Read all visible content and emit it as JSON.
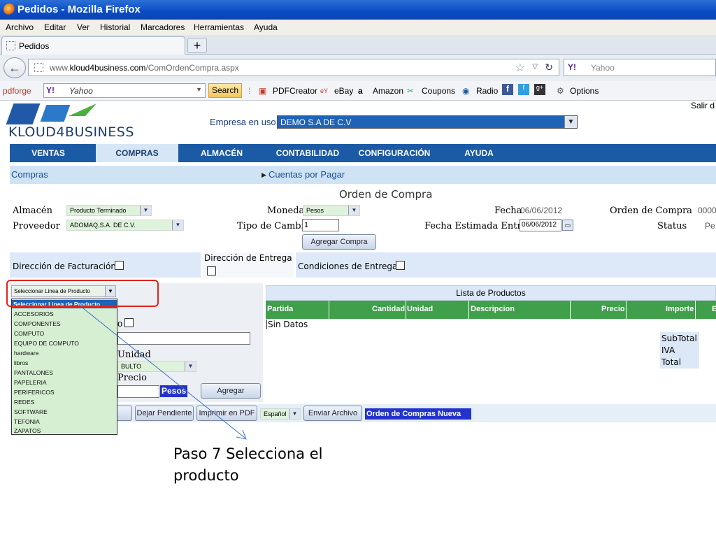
{
  "browser": {
    "window_title": "Pedidos - Mozilla Firefox",
    "menu": [
      "Archivo",
      "Editar",
      "Ver",
      "Historial",
      "Marcadores",
      "Herramientas",
      "Ayuda"
    ],
    "tab_label": "Pedidos",
    "new_tab": "+",
    "back": "←",
    "url_prefix": "www.",
    "url_domain": "kloud4business.com",
    "url_path": "/ComOrdenCompra.aspx",
    "search_engine": "Y!",
    "search_placeholder": "Yahoo",
    "toolbar": {
      "pdfforge": "pdforge",
      "yahoo_engine": "Y!",
      "yahoo_box": "Yahoo",
      "search_btn": "Search",
      "items": [
        "PDFCreator",
        "eBay",
        "Amazon",
        "Coupons",
        "Radio",
        "Options"
      ]
    }
  },
  "app": {
    "logo": "KLOUD4BUSINESS",
    "logout": "Salir d",
    "empresa_label": "Empresa en uso:",
    "empresa_value": "DEMO S.A DE C.V",
    "nav": [
      "VENTAS",
      "COMPRAS",
      "ALMACÉN",
      "CONTABILIDAD",
      "CONFIGURACIÓN",
      "AYUDA"
    ],
    "subnav_left": "Compras",
    "subnav_right": "Cuentas por Pagar",
    "page_title": "Orden de Compra",
    "form": {
      "almacen_label": "Almacén",
      "almacen_value": "Producto Terminado",
      "proveedor_label": "Proveedor",
      "proveedor_value": "ADOMAQ,S.A. DE C.V.",
      "moneda_label": "Moneda",
      "moneda_value": "Pesos",
      "tipo_cambio_label": "Tipo de Cambio",
      "tipo_cambio_value": "1",
      "fecha_label": "Fecha",
      "fecha_value": "06/06/2012",
      "fecha_entrega_label": "Fecha Estimada Entrega",
      "fecha_entrega_value": "06/06/2012",
      "orden_label": "Orden de Compra",
      "orden_value": "0000",
      "status_label": "Status",
      "status_value": "Pe",
      "agregar_compra": "Agregar Compra"
    },
    "sections": {
      "facturacion": "Dirección de Facturación",
      "entrega": "Dirección de Entrega",
      "condiciones": "Condiciones de Entrega"
    },
    "product_line_select": "Seleccionar Linea de Producto",
    "product_line_options": [
      "Seleccionar Linea de Producto",
      "ACCESORIOS",
      "COMPONENTES",
      "COMPUTO",
      "EQUIPO DE COMPUTO",
      "hardware",
      "libros",
      "PANTALONES",
      "PAPELERIA",
      "PERIFERICOS",
      "REDES",
      "SOFTWARE",
      "TEFONIA",
      "ZAPATOS"
    ],
    "left_form": {
      "partial_label": "o",
      "unidad_label": "Unidad",
      "unidad_value": "BULTO",
      "precio_label": "Precio",
      "moneda_tag": "Pesos",
      "agregar": "Agregar"
    },
    "product_list": {
      "title": "Lista de Productos",
      "columns": [
        "Partida",
        "Cantidad",
        "Unidad",
        "Descripcion",
        "Precio",
        "Importe",
        "E"
      ],
      "empty": "Sin Datos",
      "totals": [
        "SubTotal",
        "IVA",
        "Total"
      ]
    },
    "bottom": {
      "dejar_pendiente": "Dejar Pendiente",
      "imprimir": "Imprimir en PDF",
      "idioma": "Español",
      "enviar": "Enviar Archivo",
      "nueva": "Orden de Compras Nueva"
    }
  },
  "annotation": {
    "line1": "Paso 7 Selecciona el",
    "line2": "producto"
  },
  "colors": {
    "nav_blue": "#1b5aa5",
    "highlight_red": "#e0251b",
    "table_green": "#3f9f4a"
  }
}
